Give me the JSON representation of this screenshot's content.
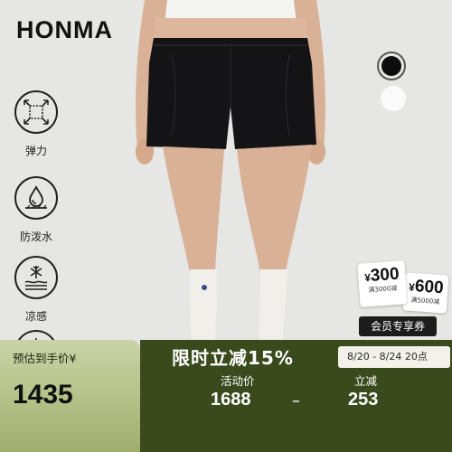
{
  "brand": "HONMA",
  "features": [
    {
      "icon": "stretch-arrows-icon",
      "label": "弹力"
    },
    {
      "icon": "water-repellent-icon",
      "label": "防泼水"
    },
    {
      "icon": "snowflake-cool-icon",
      "label": "凉感"
    }
  ],
  "colors": {
    "swatch_black": "#0d0d0d",
    "swatch_white": "#fafafa",
    "promo_green": "#3b4a1d"
  },
  "coupons": [
    {
      "amount": "300",
      "currency": "¥",
      "condition": "满3000减"
    },
    {
      "amount": "600",
      "currency": "¥",
      "condition": "满5000减"
    }
  ],
  "member_label": "会员专享券",
  "promo": {
    "preorder_label": "预估到手价¥",
    "preorder_price": "1435",
    "title": "限时立减15%",
    "date_range": "8/20 - 8/24 20点",
    "activity_label": "活动价",
    "activity_price": "1688",
    "separator": "–",
    "save_label": "立减",
    "save_amount": "253"
  }
}
